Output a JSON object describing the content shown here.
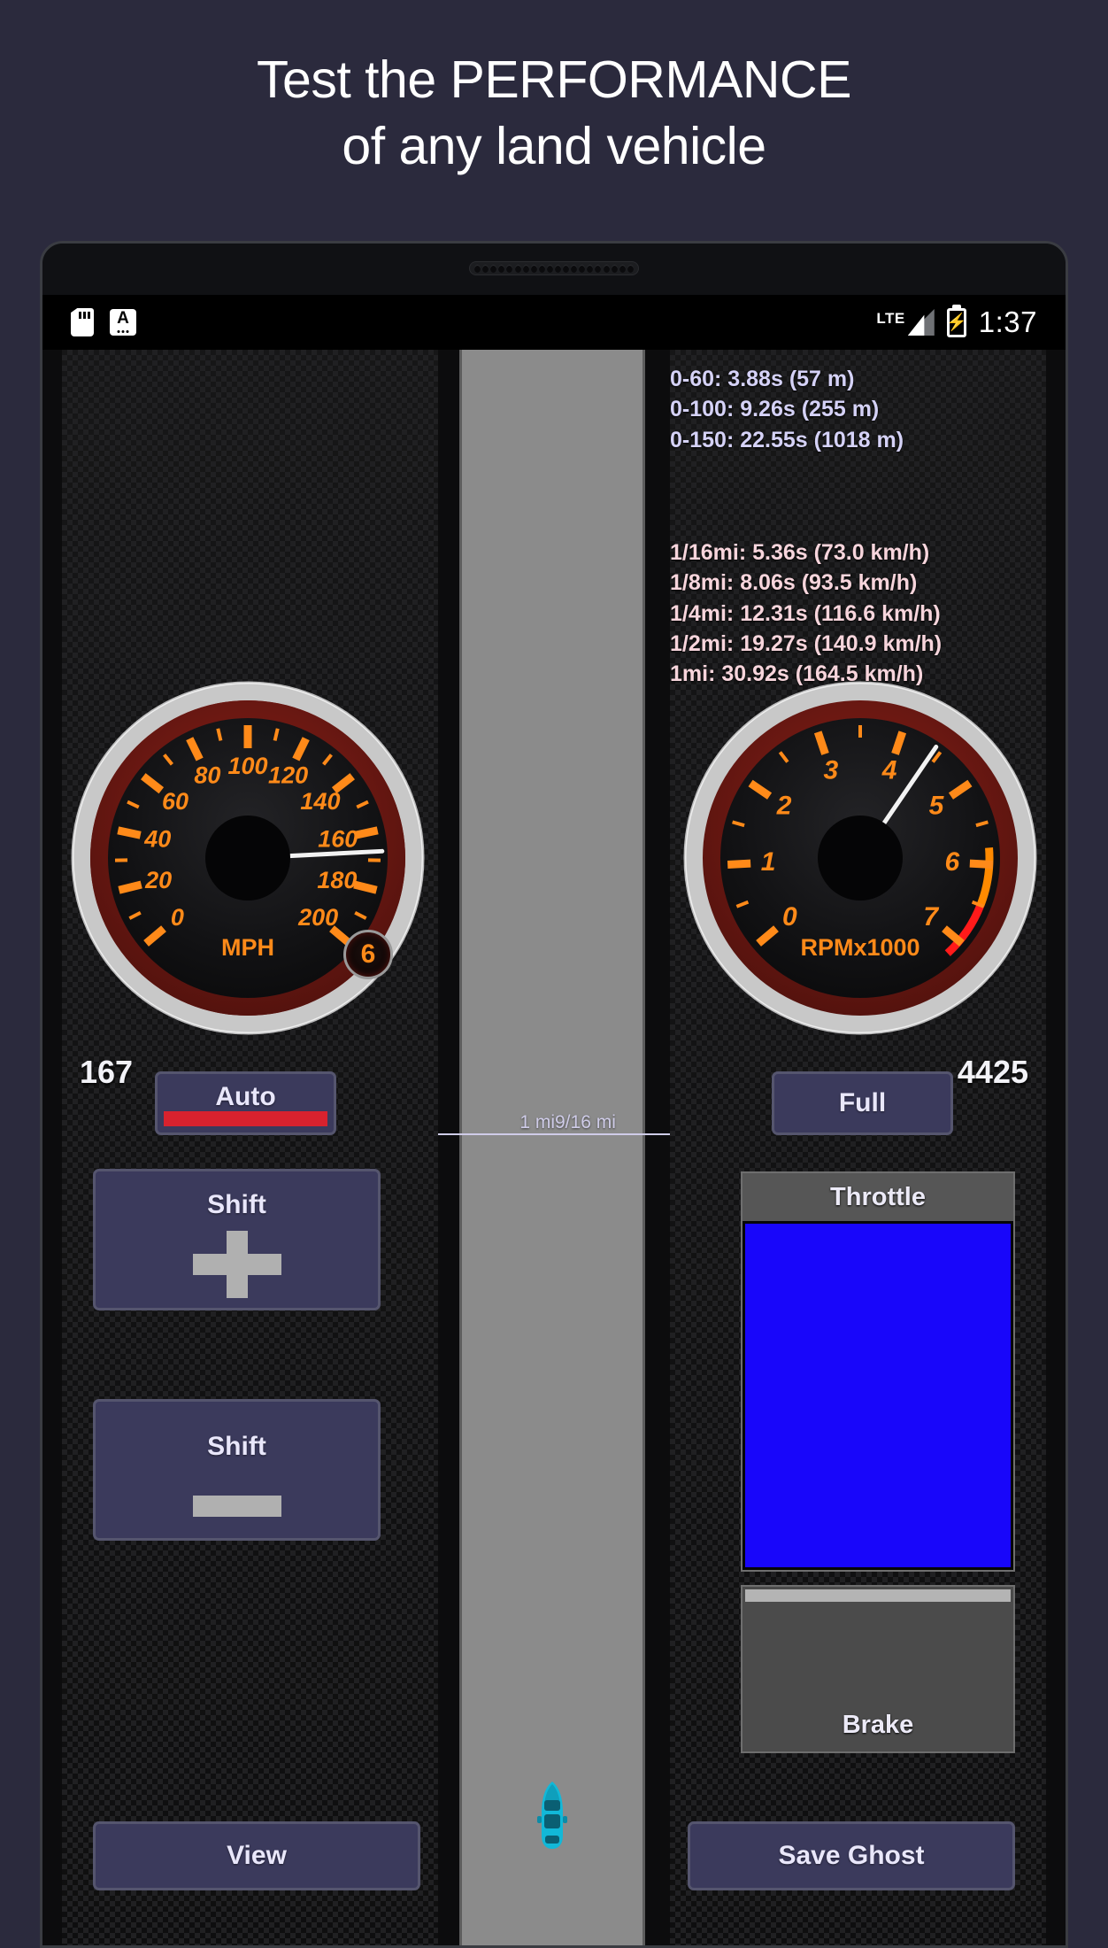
{
  "promo": {
    "line1": "Test the PERFORMANCE",
    "line2": "of any land vehicle"
  },
  "status_bar": {
    "sd_icon": "sd-card-icon",
    "keyboard_icon": "keyboard-input-icon",
    "network_label": "LTE",
    "signal_icon": "signal-bars-icon",
    "battery_icon": "battery-charging-icon",
    "battery_glyph": "⚡",
    "clock": "1:37"
  },
  "stats": {
    "acceleration": [
      "0-60: 3.88s (57 m)",
      "0-100: 9.26s (255 m)",
      "0-150: 22.55s (1018 m)"
    ],
    "distance": [
      "1/16mi: 5.36s (73.0 km/h)",
      "1/8mi: 8.06s (93.5 km/h)",
      "1/4mi: 12.31s (116.6 km/h)",
      "1/2mi: 19.27s (140.9 km/h)",
      "1mi: 30.92s (164.5 km/h)"
    ],
    "accel_color": "#d5d2f7",
    "dist_color": "#f7d5dc"
  },
  "speedometer": {
    "unit_label": "MPH",
    "ticks": [
      "0",
      "20",
      "40",
      "60",
      "80",
      "100",
      "120",
      "140",
      "160",
      "180",
      "200"
    ],
    "min": 0,
    "max": 200,
    "value": 167,
    "readout": "167",
    "needle_color": "#f2f2f2",
    "tick_color": "#ff8a19"
  },
  "tachometer": {
    "unit_label": "RPMx1000",
    "ticks": [
      "0",
      "1",
      "2",
      "3",
      "4",
      "5",
      "6",
      "7"
    ],
    "min": 0,
    "max": 7,
    "value": 4.425,
    "readout": "4425",
    "warn_zone_start": 5.8,
    "warn_zone_end": 6.5,
    "red_zone_start": 6.5,
    "red_zone_end": 7.2,
    "needle_color": "#f2f2f2",
    "tick_color": "#ff8a19",
    "warn_color": "#ff8a00",
    "red_color": "#ff1a1a"
  },
  "gear": {
    "value": "6"
  },
  "controls": {
    "auto_label": "Auto",
    "full_label": "Full",
    "shift_up_label": "Shift",
    "shift_down_label": "Shift",
    "view_label": "View",
    "save_ghost_label": "Save Ghost",
    "auto_indicator_color": "#d8222e",
    "button_bg": "#3b3a5c"
  },
  "throttle": {
    "label": "Throttle",
    "fill_percent": 100,
    "fill_color": "#1806fa"
  },
  "brake": {
    "label": "Brake",
    "fill_percent": 0,
    "panel_color": "#4b4b4b"
  },
  "track": {
    "marker_label_left": "1 mi",
    "marker_label_right": "9/16 mi",
    "car_icon": "car-top-view-icon",
    "car_color": "#12b8d8",
    "surface_color": "#8b8b8b"
  }
}
